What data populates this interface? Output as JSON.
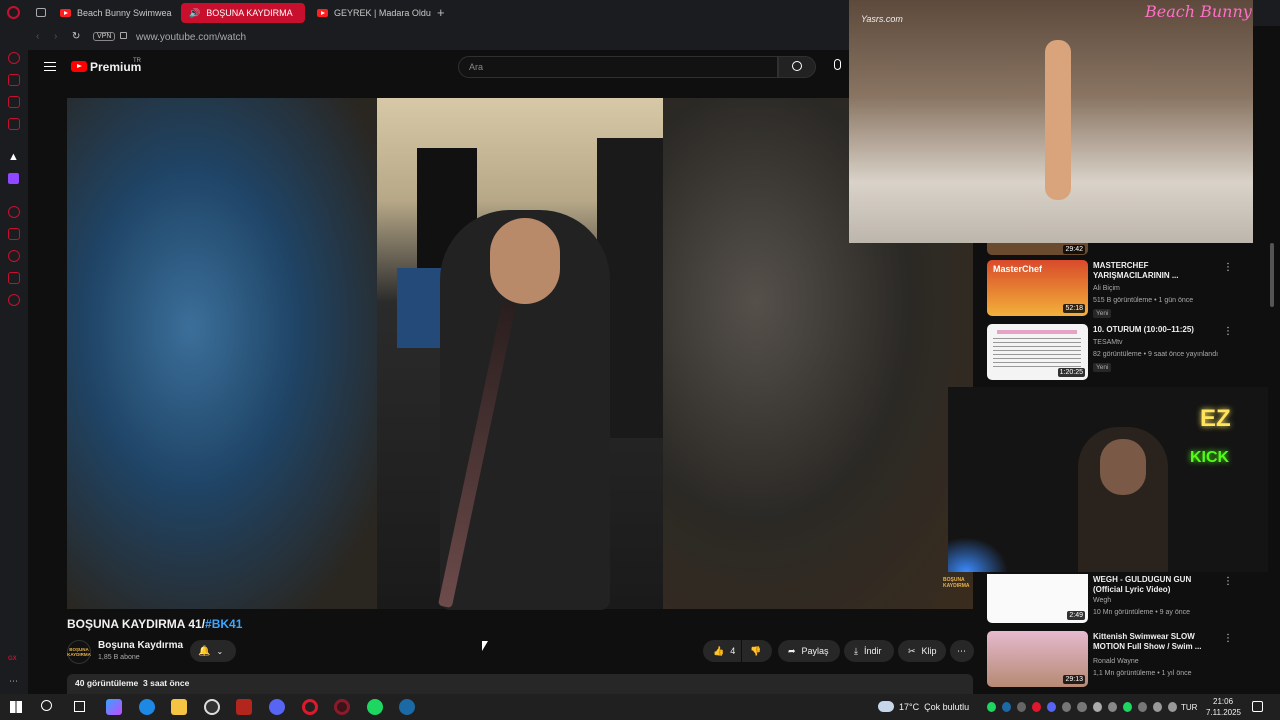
{
  "tabs": [
    {
      "label": "Beach Bunny Swimwear F"
    },
    {
      "label": "BOŞUNA KAYDIRMA"
    },
    {
      "label": "GEYREK | Madara Olduk"
    }
  ],
  "address": {
    "vpn": "VPN",
    "url": "www.youtube.com/watch"
  },
  "youtube": {
    "logo": "Premium",
    "logo_sup": "TR",
    "search_placeholder": "Ara"
  },
  "video": {
    "title": "BOŞUNA KAYDIRMA 41/",
    "hashtag": "#BK41",
    "channel": "Boşuna Kaydırma",
    "subscribers": "1,85 B abone",
    "channel_avatar_text": "BOŞUNA KAYDIRMA",
    "likes": "4",
    "share": "Paylaş",
    "download": "İndir",
    "clip": "Klip",
    "views": "40 görüntüleme",
    "age": "3 saat önce",
    "watermark": "BOŞUNA KAYDIRMA"
  },
  "overlay": {
    "cam1_watermark": "Yasrs.com",
    "cam1_brand": "Beach Bunny",
    "cam2_sign_1": "EZ",
    "cam2_sign_2": "KICK"
  },
  "recommendations": [
    {
      "title": "MASTERCHEF YARIŞMACILARININ ...",
      "channel": "Ali Biçim",
      "meta": "515 B görüntüleme • 1 gün önce",
      "badge": "Yeni",
      "duration": "52:18",
      "thumb_text": "MasterChef"
    },
    {
      "title": "10. OTURUM (10:00–11:25)",
      "channel": "TESAMtv",
      "meta": "82 görüntüleme • 9 saat önce yayınlandı",
      "badge": "Yeni",
      "duration": "1:20:25"
    },
    {
      "title": "WEGH - GULDUGUN GUN (Official Lyric Video)",
      "channel": "Wegh",
      "meta": "10 Mn görüntüleme • 9 ay önce",
      "duration": "2:49"
    },
    {
      "title": "Kittenish Swimwear SLOW MOTION Full Show / Swim ...",
      "channel": "Ronald Wayne",
      "meta": "1,1 Mn görüntüleme • 1 yıl önce",
      "duration": "29:13"
    }
  ],
  "partial_duration": "29:42",
  "taskbar": {
    "weather": "17°C  Çok bulutlu",
    "lang": "TUR",
    "time": "21:06",
    "date": "7.11.2025"
  },
  "colors": {
    "opera_red": "#c8102e",
    "yt_red": "#ff0000",
    "link_blue": "#3ea6ff"
  }
}
